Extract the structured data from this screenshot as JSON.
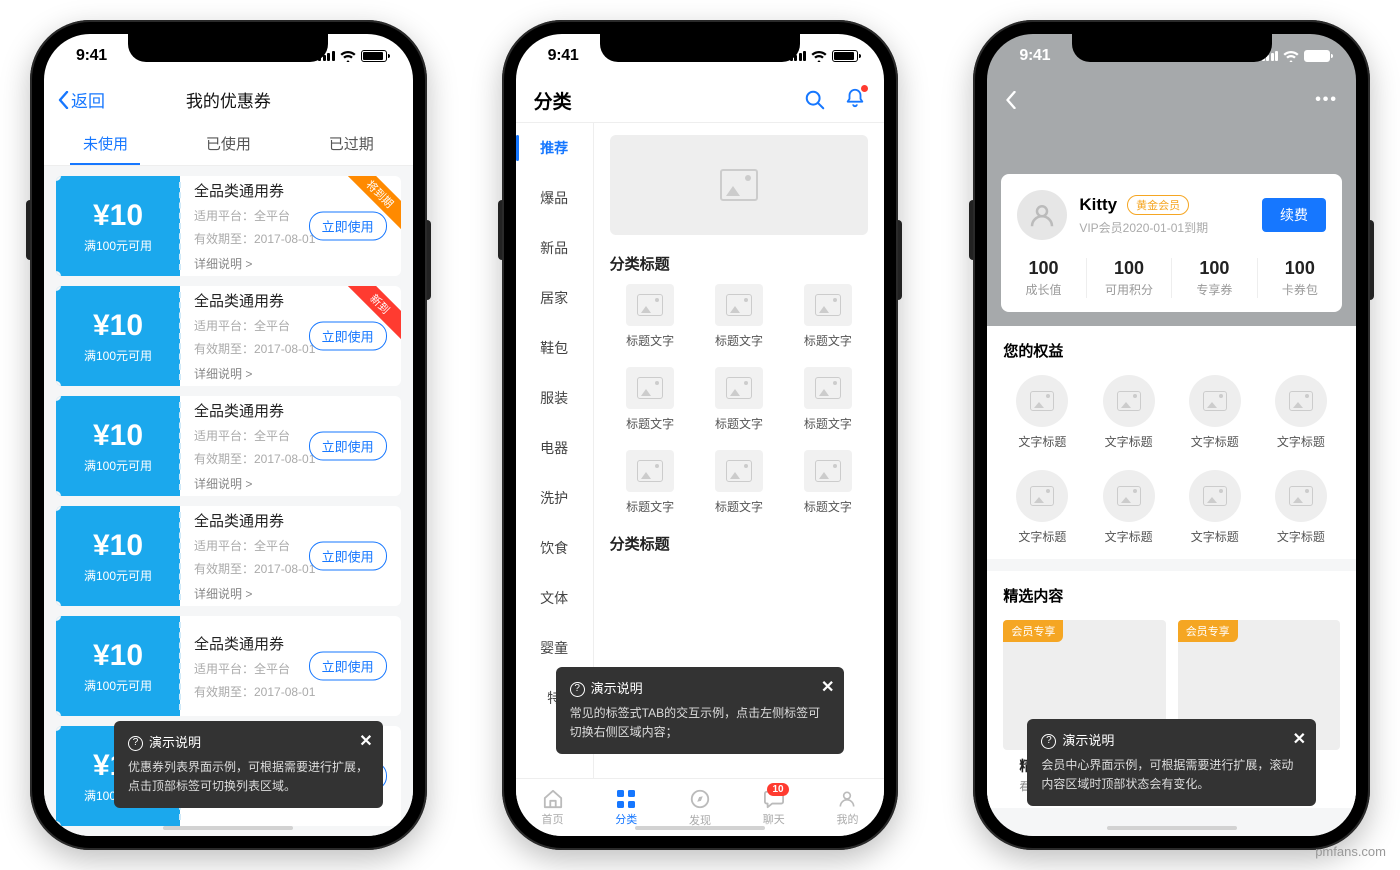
{
  "statusbar": {
    "time": "9:41"
  },
  "watermark": "pmfans.com",
  "phone1": {
    "back": "返回",
    "title": "我的优惠券",
    "tabs": [
      "未使用",
      "已使用",
      "已过期"
    ],
    "coupon": {
      "value": "¥10",
      "cond": "满100元可用",
      "name": "全品类通用券",
      "platform": "适用平台：全平台",
      "expire": "有效期至：2017-08-01",
      "detail": "详细说明 >",
      "use": "立即使用"
    },
    "ribbon_expiring": "将到期",
    "ribbon_new": "新到",
    "tip_title": "演示说明",
    "tip_body": "优惠券列表界面示例，可根据需要进行扩展，点击顶部标签可切换列表区域。"
  },
  "phone2": {
    "title": "分类",
    "side": [
      "推荐",
      "爆品",
      "新品",
      "居家",
      "鞋包",
      "服装",
      "电器",
      "洗护",
      "饮食",
      "文体",
      "婴童",
      "特"
    ],
    "section": "分类标题",
    "item_label": "标题文字",
    "tabbar": [
      {
        "label": "首页"
      },
      {
        "label": "分类"
      },
      {
        "label": "发现"
      },
      {
        "label": "聊天",
        "badge": "10"
      },
      {
        "label": "我的"
      }
    ],
    "tip_title": "演示说明",
    "tip_body": "常见的标签式TAB的交互示例，点击左侧标签可切换右侧区域内容；"
  },
  "phone3": {
    "name": "Kitty",
    "member_tag": "黄金会员",
    "sub": "VIP会员2020-01-01到期",
    "renew": "续费",
    "stats": [
      {
        "n": "100",
        "l": "成长值"
      },
      {
        "n": "100",
        "l": "可用积分"
      },
      {
        "n": "100",
        "l": "专享券"
      },
      {
        "n": "100",
        "l": "卡券包"
      }
    ],
    "benefits_title": "您的权益",
    "benefit_label": "文字标题",
    "featured_title": "精选内容",
    "featured_tag": "会员专享",
    "featured_item_title": "精英部队",
    "featured_item_sub": "看反恐精英如何御敌",
    "tip_title": "演示说明",
    "tip_body": "会员中心界面示例，可根据需要进行扩展，滚动内容区域时顶部状态会有变化。"
  }
}
